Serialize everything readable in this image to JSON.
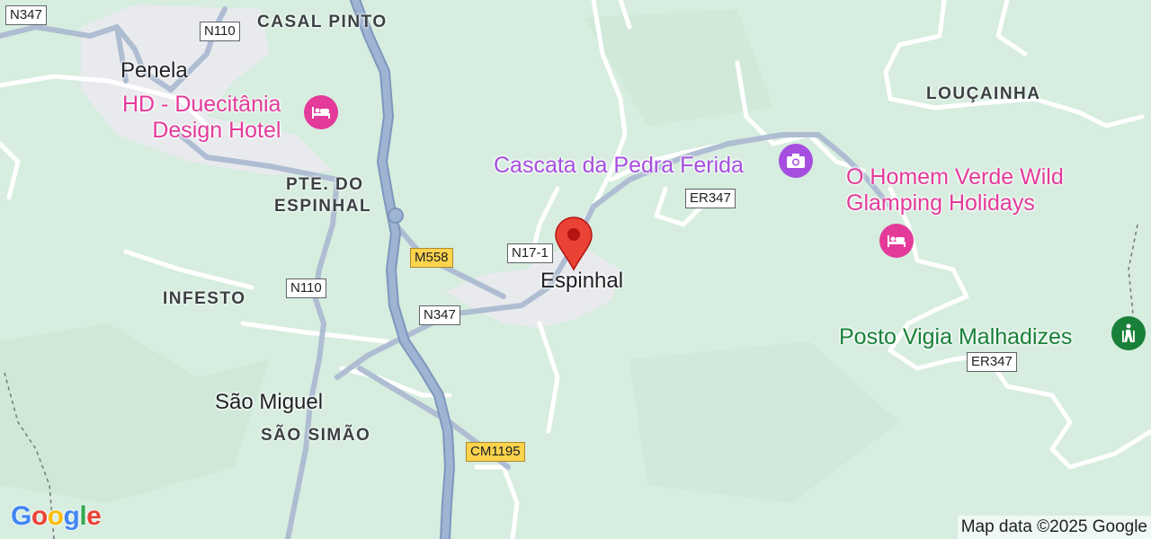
{
  "places": {
    "penela": "Penela",
    "espinhal": "Espinhal",
    "sao_miguel": "São Miguel"
  },
  "areas": {
    "casal_pinto": "CASAL PINTO",
    "loucainha": "LOUÇAINHA",
    "pte_line1": "PTE. DO",
    "pte_line2": "ESPINHAL",
    "infesto": "INFESTO",
    "sao_simao": "SÃO SIMÃO"
  },
  "pois": {
    "hotel1_line1": "HD - Duecitânia",
    "hotel1_line2": "Design Hotel",
    "cascata": "Cascata da Pedra Ferida",
    "glamping_line1": "O Homem Verde Wild",
    "glamping_line2": "Glamping Holidays",
    "posto": "Posto Vigia Malhadizes"
  },
  "roads": {
    "n347_a": "N347",
    "n110_a": "N110",
    "er347_a": "ER347",
    "m558": "M558",
    "n17_1": "N17-1",
    "n110_b": "N110",
    "n347_b": "N347",
    "er347_b": "ER347",
    "cm1195": "CM1195"
  },
  "attribution": "Map data ©2025 Google",
  "logo": {
    "g1": "G",
    "o1": "o",
    "o2": "o",
    "g2": "g",
    "l": "l",
    "e": "e"
  },
  "colors": {
    "terrain": "#d6eddf",
    "urban": "#e8eaed",
    "highway": "#8ea7c9",
    "road": "#aebdd2",
    "hotel_poi": "#e43a9a",
    "attraction_poi": "#a64ee0",
    "park_poi": "#188038",
    "pin": "#ea4335"
  }
}
